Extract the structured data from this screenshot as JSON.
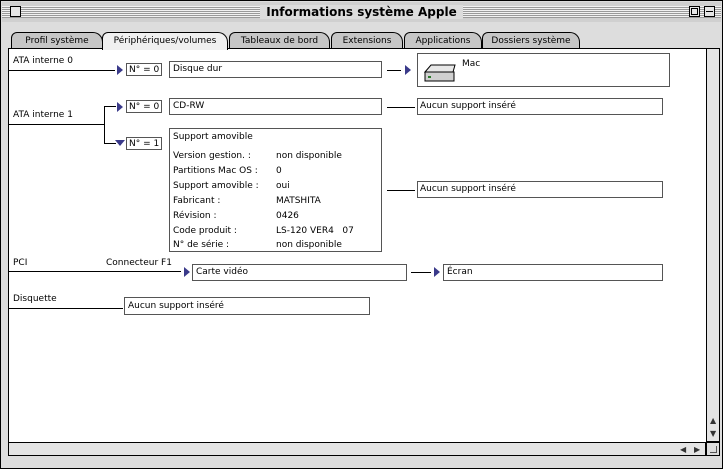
{
  "window": {
    "title": "Informations système Apple"
  },
  "tabs": [
    {
      "label": "Profil système"
    },
    {
      "label": "Périphériques/volumes",
      "active": true
    },
    {
      "label": "Tableaux de bord"
    },
    {
      "label": "Extensions"
    },
    {
      "label": "Applications"
    },
    {
      "label": "Dossiers système"
    }
  ],
  "ata0": {
    "bus_label": "ATA interne 0",
    "id": "N° = 0",
    "device": "Disque dur",
    "volume": "Mac"
  },
  "ata1": {
    "bus_label": "ATA interne 1",
    "dev0": {
      "id": "N° = 0",
      "device": "CD-RW",
      "media": "Aucun support inséré"
    },
    "dev1": {
      "id": "N° = 1",
      "title": "Support amovible",
      "rows": [
        {
          "key": "Version gestion. :",
          "value": "non disponible"
        },
        {
          "key": "Partitions Mac OS :",
          "value": "0"
        },
        {
          "key": "Support amovible :",
          "value": "oui"
        },
        {
          "key": "Fabricant :",
          "value": "MATSHITA"
        },
        {
          "key": "Révision :",
          "value": "0426"
        },
        {
          "key": "Code produit :",
          "value": "LS-120 VER4   07"
        },
        {
          "key": "N° de série :",
          "value": "non disponible"
        }
      ],
      "media": "Aucun support inséré"
    }
  },
  "pci": {
    "bus_label": "PCI",
    "connector": "Connecteur F1",
    "device": "Carte vidéo",
    "display": "Écran"
  },
  "floppy": {
    "bus_label": "Disquette",
    "media": "Aucun support inséré"
  },
  "icons": {
    "disclosure_collapsed": "triangle-right",
    "disclosure_expanded": "triangle-down",
    "volume": "hard-disk"
  },
  "colors": {
    "disclosure_triangle": "#3a3a8a",
    "window_bg": "#dddddd"
  }
}
